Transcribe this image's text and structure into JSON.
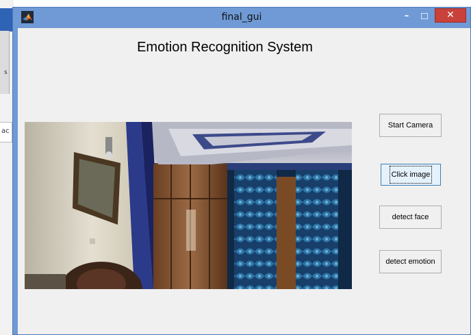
{
  "window": {
    "title": "final_gui",
    "min_glyph": "–",
    "close_glyph": "✕"
  },
  "background_window": {
    "fragment_text_1": "s",
    "fragment_text_2": "ac"
  },
  "heading": "Emotion Recognition System",
  "camera_view": {
    "icon": "camera-feed-image",
    "description_visible": ""
  },
  "buttons": {
    "start_camera": "Start Camera",
    "click_image": "Click image",
    "detect_face": "detect face",
    "detect_emotion": "detect emotion"
  },
  "colors": {
    "titlebar": "#6f9ad5",
    "close_button": "#c9413b",
    "client_bg": "#f0f0f0",
    "focus_button": "#e5f1fb"
  }
}
